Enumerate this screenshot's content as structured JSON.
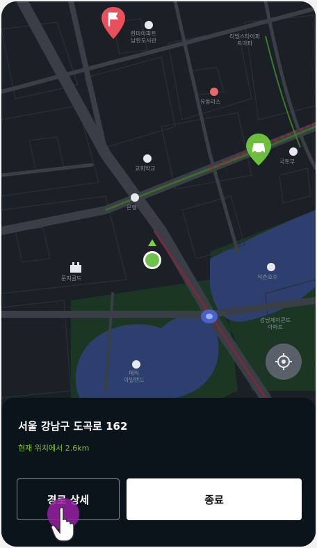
{
  "map": {
    "labels": {
      "top_place_1": "한마아파트\n남한도서관",
      "top_place_2": "리빙스타아파\n트아파",
      "restaurant": "유동라스",
      "school": "교회학교",
      "bank": "은행",
      "right_place": "국토부",
      "park_building": "문지골드",
      "lake_poi": "석촌호수",
      "lower_right": "강남제이콘트\n아파트",
      "island": "매직\n아일랜드"
    }
  },
  "icons": {
    "destination": "flag-pin-icon",
    "parking": "car-pin-icon",
    "current_location": "current-location-icon",
    "heading": "heading-arrow-icon",
    "locate": "crosshair-icon",
    "hand": "hand-pointer-icon"
  },
  "sheet": {
    "address": "서울 강남구 도곡로 162",
    "distance": "현재 위치에서 2.6km",
    "detail_button": "경로 상세",
    "end_button": "종료"
  },
  "colors": {
    "map_background": "#1b1f26",
    "water": "#2c3f6e",
    "park": "#1b3622",
    "accent_green": "#7fbf3f",
    "sheet_background": "#0c141b",
    "tap_highlight": "#961ea0"
  }
}
